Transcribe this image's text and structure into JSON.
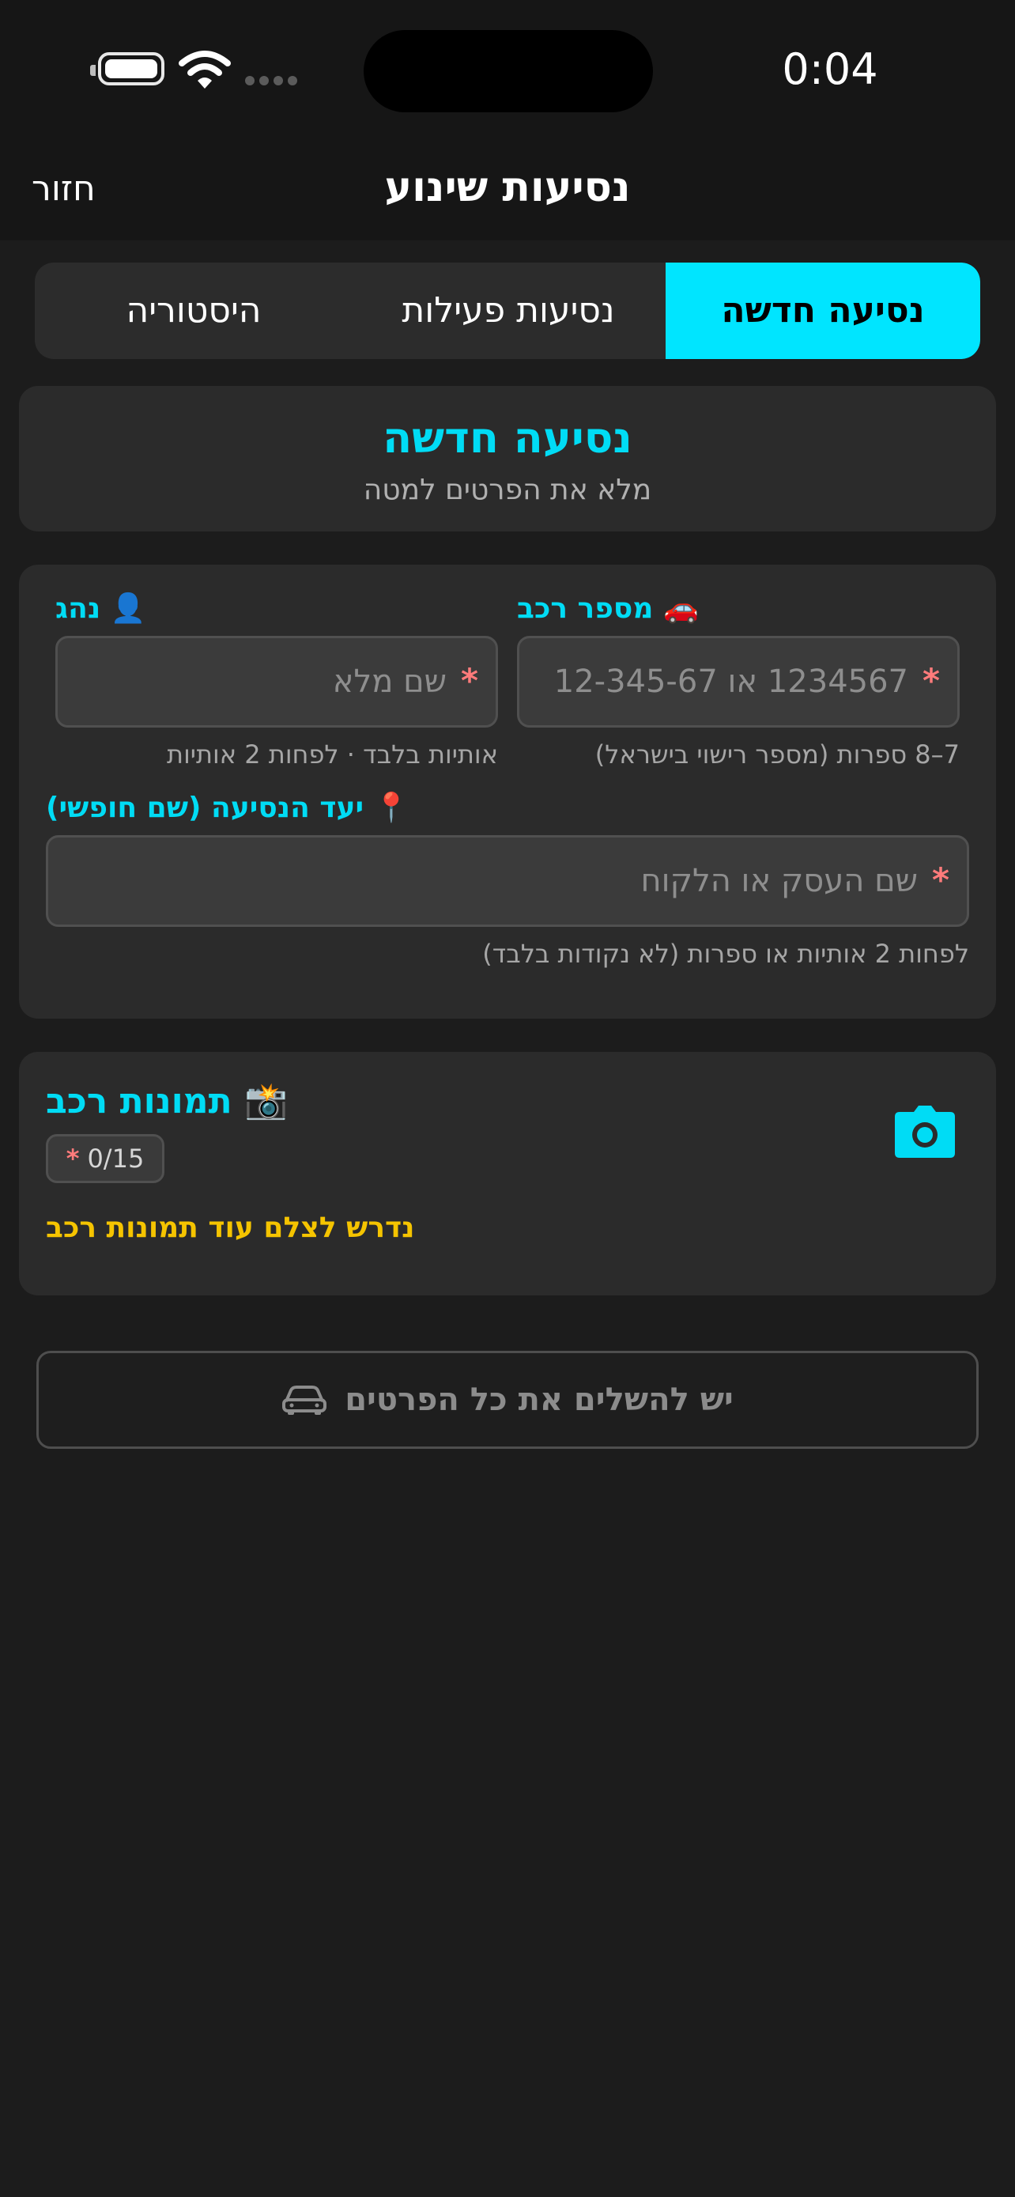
{
  "status_bar": {
    "time": "0:04"
  },
  "nav": {
    "back_label": "חזור",
    "title": "נסיעות שינוע"
  },
  "tabs": [
    {
      "label": "נסיעה חדשה",
      "active": true
    },
    {
      "label": "נסיעות פעילות",
      "active": false
    },
    {
      "label": "היסטוריה",
      "active": false
    }
  ],
  "hero": {
    "title": "נסיעה חדשה",
    "subtitle": "מלא את הפרטים למטה"
  },
  "form": {
    "vehicle": {
      "label": "🚗 מספר רכב",
      "placeholder": "1234567 או 12-345-67",
      "required_mark": "*",
      "hint": "7–8 ספרות (מספר רישוי בישראל)"
    },
    "driver": {
      "label": "👤 נהג",
      "placeholder": "שם מלא",
      "required_mark": "*",
      "hint": "אותיות בלבד · לפחות 2 אותיות"
    },
    "destination": {
      "label": "📍 יעד הנסיעה (שם חופשי)",
      "placeholder": "שם העסק או הלקוח",
      "required_mark": "*",
      "hint": "לפחות 2 אותיות או ספרות (לא נקודות בלבד)"
    }
  },
  "photos": {
    "label": "📸 תמונות רכב",
    "count": "0/15",
    "required_mark": "*",
    "warning": "נדרש לצלם עוד תמונות רכב",
    "icon": "camera-icon"
  },
  "submit": {
    "label": "יש להשלים את כל הפרטים",
    "icon": "car-icon"
  },
  "colors": {
    "accent": "#00e5ff",
    "warning": "#f5c400",
    "required": "#ff7b7b",
    "background": "#1c1c1c",
    "card": "#2b2b2b"
  }
}
